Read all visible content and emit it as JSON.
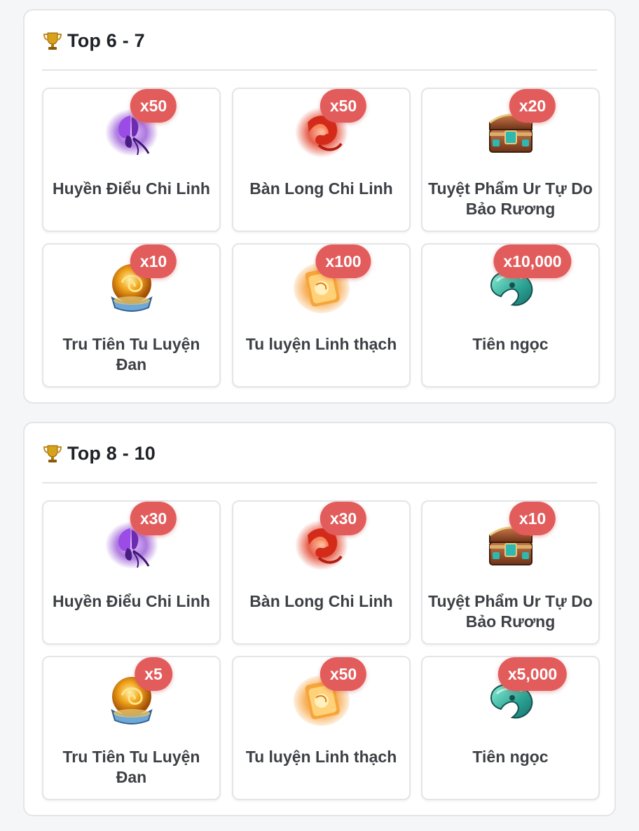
{
  "sections": [
    {
      "title": "Top 6 - 7",
      "items": [
        {
          "name": "Huyền Điểu Chi Linh",
          "qty": "x50",
          "icon": "purple-butterfly-icon"
        },
        {
          "name": "Bàn Long Chi Linh",
          "qty": "x50",
          "icon": "red-dragon-flame-icon"
        },
        {
          "name": "Tuyệt Phẩm Ur Tự Do Bảo Rương",
          "qty": "x20",
          "icon": "treasure-chest-icon"
        },
        {
          "name": "Tru Tiên Tu Luyện Đan",
          "qty": "x10",
          "icon": "golden-pill-orb-icon"
        },
        {
          "name": "Tu luyện Linh thạch",
          "qty": "x100",
          "icon": "spirit-stone-scroll-icon"
        },
        {
          "name": "Tiên ngọc",
          "qty": "x10,000",
          "icon": "jade-gem-icon"
        }
      ]
    },
    {
      "title": "Top 8 - 10",
      "items": [
        {
          "name": "Huyền Điểu Chi Linh",
          "qty": "x30",
          "icon": "purple-butterfly-icon"
        },
        {
          "name": "Bàn Long Chi Linh",
          "qty": "x30",
          "icon": "red-dragon-flame-icon"
        },
        {
          "name": "Tuyệt Phẩm Ur Tự Do Bảo Rương",
          "qty": "x10",
          "icon": "treasure-chest-icon"
        },
        {
          "name": "Tru Tiên Tu Luyện Đan",
          "qty": "x5",
          "icon": "golden-pill-orb-icon"
        },
        {
          "name": "Tu luyện Linh thạch",
          "qty": "x50",
          "icon": "spirit-stone-scroll-icon"
        },
        {
          "name": "Tiên ngọc",
          "qty": "x5,000",
          "icon": "jade-gem-icon"
        }
      ]
    }
  ],
  "colors": {
    "badge": "#e25c5c",
    "card_border": "#e3e5e8",
    "page_bg": "#f5f6f8"
  }
}
